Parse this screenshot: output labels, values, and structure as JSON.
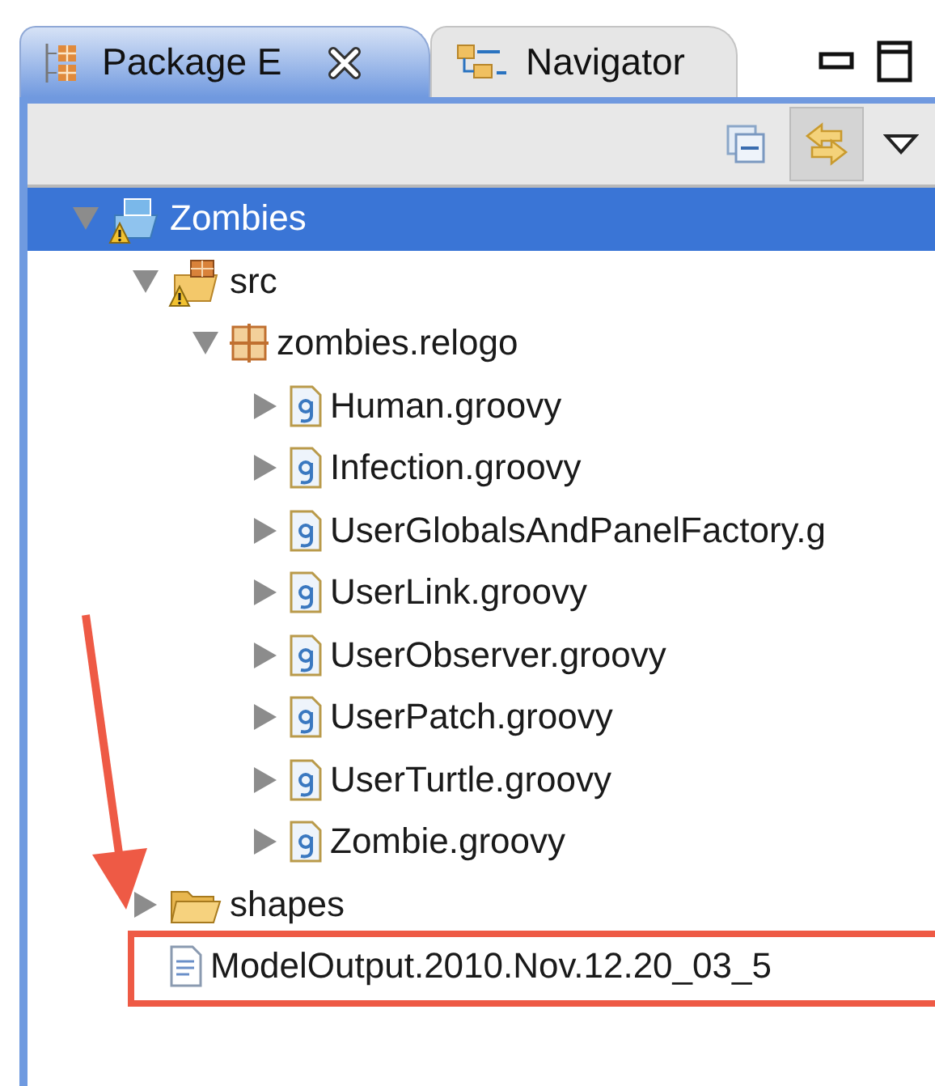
{
  "tabs": [
    {
      "label": "Package E",
      "kind": "packages",
      "selected": true,
      "closable": true
    },
    {
      "label": "Navigator",
      "kind": "navigator",
      "selected": false,
      "closable": false
    }
  ],
  "tree": [
    {
      "label": "Zombies",
      "kind": "project",
      "expanded": true,
      "selected": true,
      "warning": true,
      "children": [
        {
          "label": "src",
          "kind": "source-folder",
          "expanded": true,
          "selected": false,
          "warning": true,
          "children": [
            {
              "label": "zombies.relogo",
              "kind": "package",
              "expanded": true,
              "selected": false,
              "children": [
                {
                  "label": "Human.groovy",
                  "kind": "groovy-file",
                  "expanded": false,
                  "selected": false
                },
                {
                  "label": "Infection.groovy",
                  "kind": "groovy-file",
                  "expanded": false,
                  "selected": false
                },
                {
                  "label": "UserGlobalsAndPanelFactory.g",
                  "kind": "groovy-file",
                  "expanded": false,
                  "selected": false
                },
                {
                  "label": "UserLink.groovy",
                  "kind": "groovy-file",
                  "expanded": false,
                  "selected": false
                },
                {
                  "label": "UserObserver.groovy",
                  "kind": "groovy-file",
                  "expanded": false,
                  "selected": false
                },
                {
                  "label": "UserPatch.groovy",
                  "kind": "groovy-file",
                  "expanded": false,
                  "selected": false
                },
                {
                  "label": "UserTurtle.groovy",
                  "kind": "groovy-file",
                  "expanded": false,
                  "selected": false
                },
                {
                  "label": "Zombie.groovy",
                  "kind": "groovy-file",
                  "expanded": false,
                  "selected": false
                }
              ]
            }
          ]
        },
        {
          "label": "shapes",
          "kind": "folder",
          "expanded": false,
          "selected": false
        },
        {
          "label": "ModelOutput.2010.Nov.12.20_03_5",
          "kind": "text-file",
          "selected": false,
          "highlighted": true
        }
      ]
    }
  ]
}
